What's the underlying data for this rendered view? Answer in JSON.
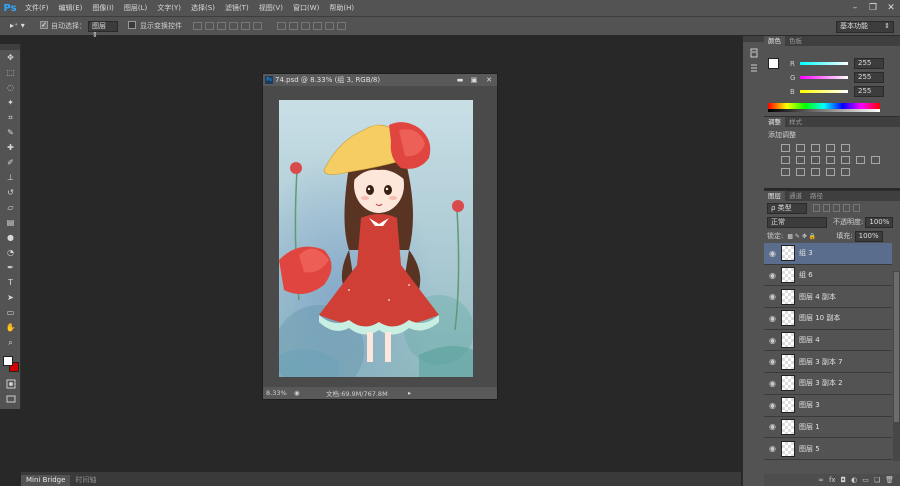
{
  "app": {
    "logo": "Ps",
    "menus": [
      "文件(F)",
      "编辑(E)",
      "图像(I)",
      "图层(L)",
      "文字(Y)",
      "选择(S)",
      "滤镜(T)",
      "视图(V)",
      "窗口(W)",
      "帮助(H)"
    ],
    "window_controls": [
      "minimize-icon",
      "restore-icon",
      "close-icon"
    ]
  },
  "options": {
    "auto_select_label": "自动选择：",
    "auto_select_value": "图层",
    "show_transform_label": "显示变换控件",
    "workspace": "基本功能"
  },
  "tools": [
    "move-icon",
    "marquee-icon",
    "lasso-icon",
    "quick-select-icon",
    "crop-icon",
    "eyedropper-icon",
    "healing-icon",
    "brush-icon",
    "clone-stamp-icon",
    "history-brush-icon",
    "eraser-icon",
    "gradient-icon",
    "blur-icon",
    "dodge-icon",
    "pen-icon",
    "type-icon",
    "path-select-icon",
    "shape-icon",
    "hand-icon",
    "zoom-icon"
  ],
  "document": {
    "title": "74.psd @ 8.33% (组 3, RGB/8)",
    "zoom": "8.33%",
    "doc_info": "文档:69.9M/767.8M"
  },
  "color_panel": {
    "tabs": [
      "颜色",
      "色板"
    ],
    "channels": [
      {
        "label": "R",
        "value": "255"
      },
      {
        "label": "G",
        "value": "255"
      },
      {
        "label": "B",
        "value": "255"
      }
    ],
    "fg_color": "#ffffff",
    "bg_color": "#d40000"
  },
  "adjust_panel": {
    "tabs": [
      "调整",
      "样式"
    ],
    "heading": "添加调整"
  },
  "layers_panel": {
    "tabs": [
      "图层",
      "通道",
      "路径"
    ],
    "filter_value": "类型",
    "blend_mode": "正常",
    "opacity_label": "不透明度:",
    "opacity_value": "100%",
    "lock_label": "锁定:",
    "fill_label": "填充:",
    "fill_value": "100%",
    "layers": [
      {
        "name": "组 3",
        "selected": true
      },
      {
        "name": "组 6",
        "selected": false
      },
      {
        "name": "图层 4 副本",
        "selected": false
      },
      {
        "name": "图层 10 副本",
        "selected": false
      },
      {
        "name": "图层 4",
        "selected": false
      },
      {
        "name": "图层 3 副本 7",
        "selected": false
      },
      {
        "name": "图层 3 副本 2",
        "selected": false
      },
      {
        "name": "图层 3",
        "selected": false
      },
      {
        "name": "图层 1",
        "selected": false
      },
      {
        "name": "图层 5",
        "selected": false
      }
    ]
  },
  "bottom_tabs": [
    "Mini Bridge",
    "时间轴"
  ]
}
